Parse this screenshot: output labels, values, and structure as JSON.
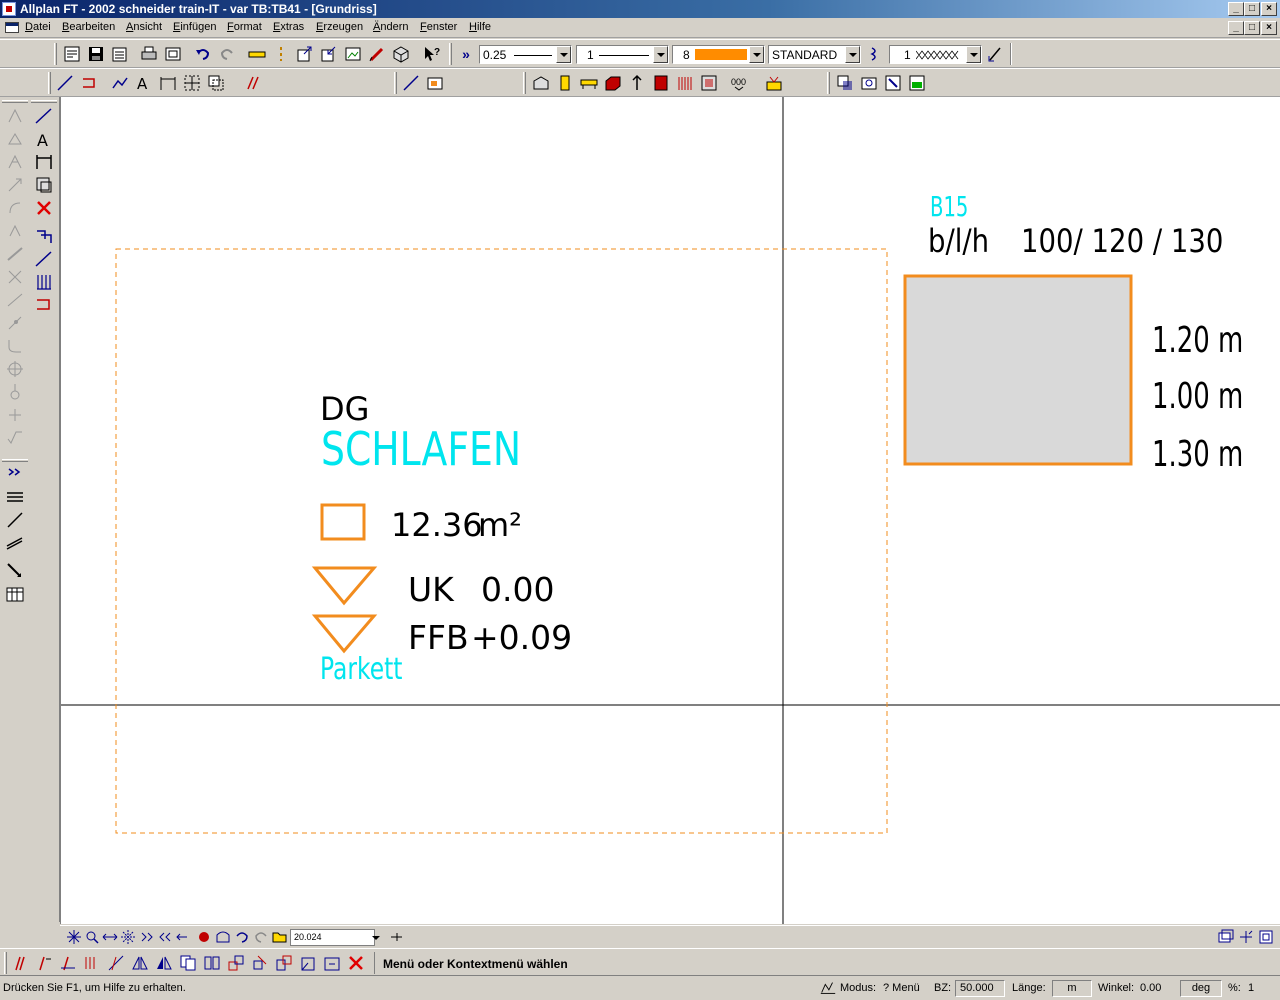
{
  "window": {
    "title": "Allplan FT - 2002 schneider train-IT - var TB:TB41 - [Grundriss]",
    "controls": {
      "minimize": "_",
      "maximize": "□",
      "close": "×"
    }
  },
  "menu": [
    "Datei",
    "Bearbeiten",
    "Ansicht",
    "Einfügen",
    "Format",
    "Extras",
    "Erzeugen",
    "Ändern",
    "Fenster",
    "Hilfe"
  ],
  "toolbar": {
    "more": "»",
    "pen_thickness": "0.25",
    "line_type": "1",
    "color_number": "8",
    "color_swatch": "#ff8c00",
    "layer": "STANDARD",
    "hatch_number": "1"
  },
  "drawing": {
    "floor_label": "DG",
    "room_name": "SCHLAFEN",
    "area_value": "12.36",
    "area_unit": "m²",
    "uk_label": "UK",
    "uk_value": "0.00",
    "ffb_label": "FFB",
    "ffb_value": "+0.09",
    "floor_finish": "Parkett",
    "block_id": "B15",
    "dims_label": "b/l/h",
    "dims_value": "100/ 120 / 130",
    "dim_1": "1.20  m",
    "dim_2": "1.00  m",
    "dim_3": "1.30  m",
    "colors": {
      "cyan": "#00e5ee",
      "orange": "#f28c1e",
      "fill": "#d9d9d9"
    }
  },
  "navigation": {
    "scale": "20.024"
  },
  "prompt": "Menü oder Kontextmenü wählen",
  "status": {
    "help": "Drücken Sie F1, um Hilfe zu erhalten.",
    "mode_label": "Modus:",
    "mode_value": "? Menü",
    "bz_label": "BZ:",
    "bz_value": "50.000",
    "length_label": "Länge:",
    "length_unit": "m",
    "angle_label": "Winkel:",
    "angle_value": "0.00",
    "angle_unit": "deg",
    "percent_label": "%:",
    "percent_value": "1"
  }
}
